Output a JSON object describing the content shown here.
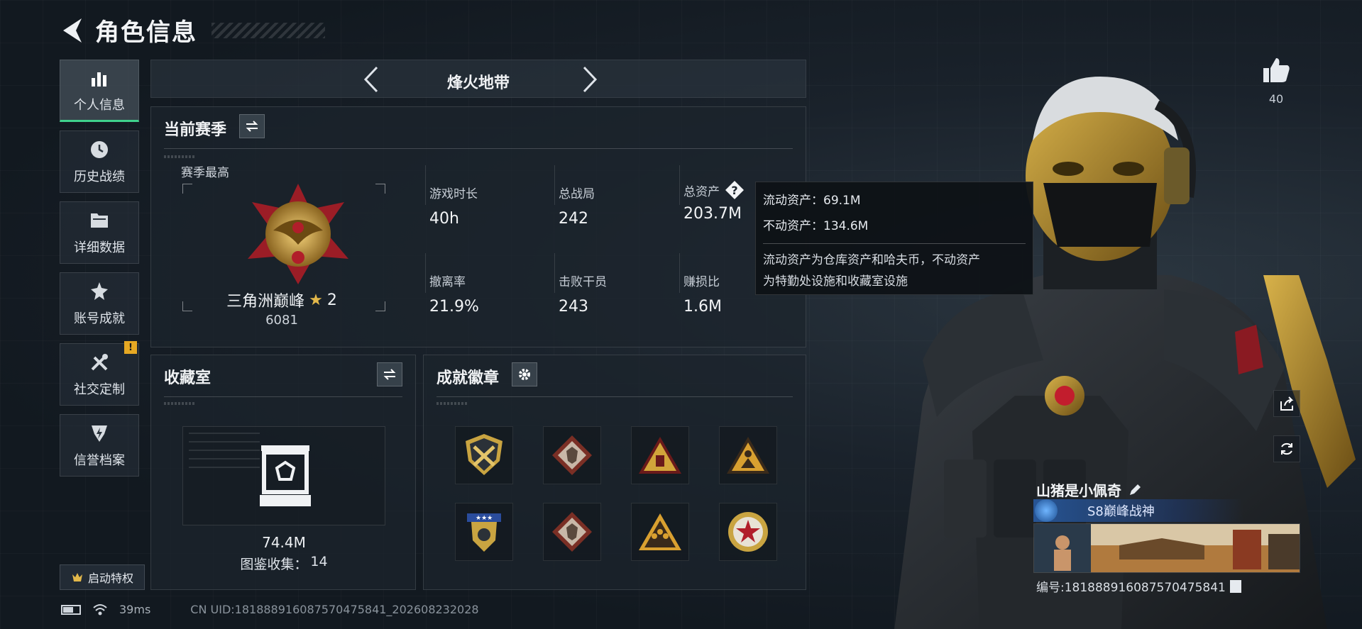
{
  "header": {
    "title": "角色信息"
  },
  "sidebar": {
    "items": [
      {
        "label": "个人信息",
        "icon": "bar-chart-icon",
        "active": true
      },
      {
        "label": "历史战绩",
        "icon": "history-icon"
      },
      {
        "label": "详细数据",
        "icon": "folder-icon"
      },
      {
        "label": "账号成就",
        "icon": "achievement-icon"
      },
      {
        "label": "社交定制",
        "icon": "tools-icon",
        "badge": "!"
      },
      {
        "label": "信誉档案",
        "icon": "credit-icon"
      }
    ],
    "privilege_label": "启动特权"
  },
  "map_selector": {
    "name": "烽火地带"
  },
  "season": {
    "title": "当前赛季",
    "best_label": "赛季最高",
    "rank_name": "三角洲巅峰",
    "rank_stars": "2",
    "rank_score": "6081",
    "stats": [
      {
        "label": "游戏时长",
        "value": "40h"
      },
      {
        "label": "总战局",
        "value": "242"
      },
      {
        "label": "总资产",
        "value": "203.7M",
        "help": true
      },
      {
        "label": "撤离率",
        "value": "21.9%"
      },
      {
        "label": "击败干员",
        "value": "243"
      },
      {
        "label": "赚损比",
        "value": "1.6M"
      }
    ]
  },
  "tooltip": {
    "liquid": "流动资产：69.1M",
    "fixed": "不动资产：134.6M",
    "desc_line1": "流动资产为仓库资产和哈夫币，不动资产",
    "desc_line2": "为特勤处设施和收藏室设施"
  },
  "collection": {
    "title": "收藏室",
    "value": "74.4M",
    "count_label": "图鉴收集：",
    "count_value": "14"
  },
  "achievements": {
    "title": "成就徽章",
    "badges": [
      "shield-crossed-icon",
      "wolf-diamond-icon",
      "triangle-gold-icon",
      "triangle-figure-icon",
      "shield-stars-icon",
      "wolf-diamond-icon",
      "triangle-squad-icon",
      "round-star-icon"
    ]
  },
  "player": {
    "name": "山猪是小佩奇",
    "title": "S8巅峰战神",
    "id": "编号:1818889160875704758​41",
    "likes": "40"
  },
  "status": {
    "ping": "39ms",
    "uid": "CN UID:1818889160875704758​41_202608232028"
  },
  "colors": {
    "accent_green": "#3fd28c",
    "gold": "#e3b84a",
    "warn": "#e6a823"
  }
}
